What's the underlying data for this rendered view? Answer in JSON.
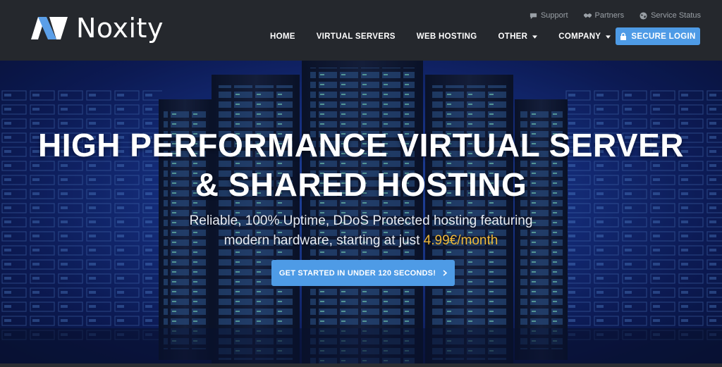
{
  "brand": {
    "name": "Noxity"
  },
  "utility_links": [
    {
      "label": "Support",
      "icon": "chat-bubble-icon"
    },
    {
      "label": "Partners",
      "icon": "handshake-icon"
    },
    {
      "label": "Service Status",
      "icon": "globe-icon"
    }
  ],
  "nav": {
    "items": [
      {
        "label": "HOME"
      },
      {
        "label": "VIRTUAL SERVERS"
      },
      {
        "label": "WEB HOSTING"
      },
      {
        "label": "OTHER"
      },
      {
        "label": "COMPANY"
      }
    ],
    "login_label": "SECURE LOGIN"
  },
  "hero": {
    "title_line1": "HIGH PERFORMANCE VIRTUAL SERVER",
    "title_line2": "& SHARED HOSTING",
    "subtitle_line1": "Reliable, 100% Uptime, DDoS Protected hosting featuring",
    "subtitle_line2": "modern hardware, starting at just",
    "price": "4.99€/month",
    "cta_label": "GET STARTED IN UNDER 120 SECONDS!"
  },
  "colors": {
    "header_bg": "#25282d",
    "accent": "#4e9be6",
    "price": "#f0b93a"
  }
}
